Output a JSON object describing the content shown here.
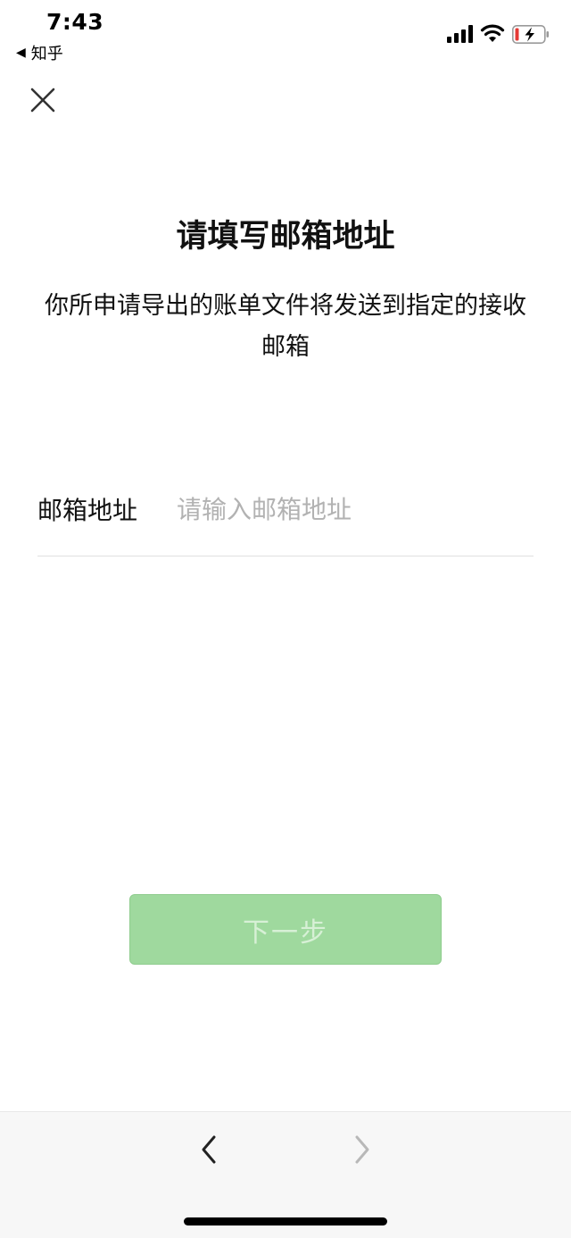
{
  "status_bar": {
    "time": "7:43",
    "back_app_label": "知乎",
    "icons": [
      "signal-icon",
      "wifi-icon",
      "battery-charging-icon"
    ]
  },
  "header": {
    "close_icon": "close-icon"
  },
  "main": {
    "title": "请填写邮箱地址",
    "description": "你所申请导出的账单文件将发送到指定的接收邮箱",
    "email_field": {
      "label": "邮箱地址",
      "value": "",
      "placeholder": "请输入邮箱地址"
    },
    "next_button_label": "下一步"
  },
  "bottom_bar": {
    "back_icon": "chevron-left-icon",
    "forward_icon": "chevron-right-icon"
  },
  "colors": {
    "accent_button": "#9fd99e",
    "button_text": "#d7f0d6",
    "placeholder": "#b2b2b2",
    "battery_low": "#e53935",
    "forward_disabled": "#b8b8b8"
  }
}
